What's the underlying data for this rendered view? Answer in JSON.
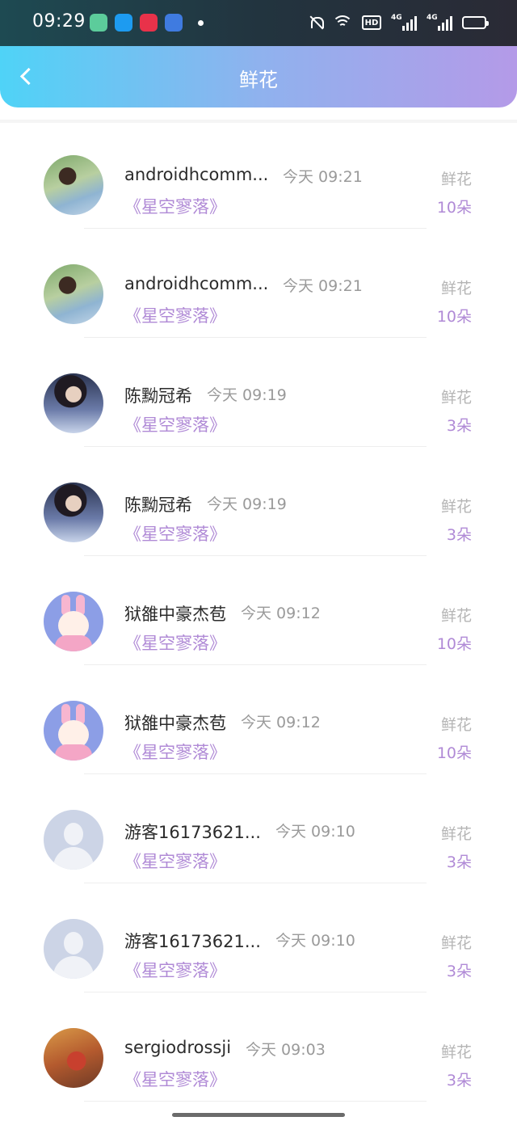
{
  "status_bar": {
    "time": "09:29",
    "hd_label": "HD",
    "signal_labels": [
      "4G",
      "4G"
    ],
    "battery_color": "#f5c23a"
  },
  "header": {
    "title": "鲜花",
    "back_icon": "chevron-left-icon"
  },
  "records": [
    {
      "avatar": "photo1",
      "username": "androidhcomm...",
      "time": "今天 09:21",
      "gift_name": "《星空寥落》",
      "gift_type": "鲜花",
      "count": "10朵"
    },
    {
      "avatar": "photo1",
      "username": "androidhcomm...",
      "time": "今天 09:21",
      "gift_name": "《星空寥落》",
      "gift_type": "鲜花",
      "count": "10朵"
    },
    {
      "avatar": "photo2",
      "username": "陈黝冠希",
      "time": "今天 09:19",
      "gift_name": "《星空寥落》",
      "gift_type": "鲜花",
      "count": "3朵"
    },
    {
      "avatar": "photo2",
      "username": "陈黝冠希",
      "time": "今天 09:19",
      "gift_name": "《星空寥落》",
      "gift_type": "鲜花",
      "count": "3朵"
    },
    {
      "avatar": "cartoon",
      "username": "狱雒中豪杰苞",
      "time": "今天 09:12",
      "gift_name": "《星空寥落》",
      "gift_type": "鲜花",
      "count": "10朵"
    },
    {
      "avatar": "cartoon",
      "username": "狱雒中豪杰苞",
      "time": "今天 09:12",
      "gift_name": "《星空寥落》",
      "gift_type": "鲜花",
      "count": "10朵"
    },
    {
      "avatar": "default",
      "username": "游客16173621...",
      "time": "今天 09:10",
      "gift_name": "《星空寥落》",
      "gift_type": "鲜花",
      "count": "3朵"
    },
    {
      "avatar": "default",
      "username": "游客16173621...",
      "time": "今天 09:10",
      "gift_name": "《星空寥落》",
      "gift_type": "鲜花",
      "count": "3朵"
    },
    {
      "avatar": "photo3",
      "username": "sergiodrossji",
      "time": "今天 09:03",
      "gift_name": "《星空寥落》",
      "gift_type": "鲜花",
      "count": "3朵"
    }
  ]
}
